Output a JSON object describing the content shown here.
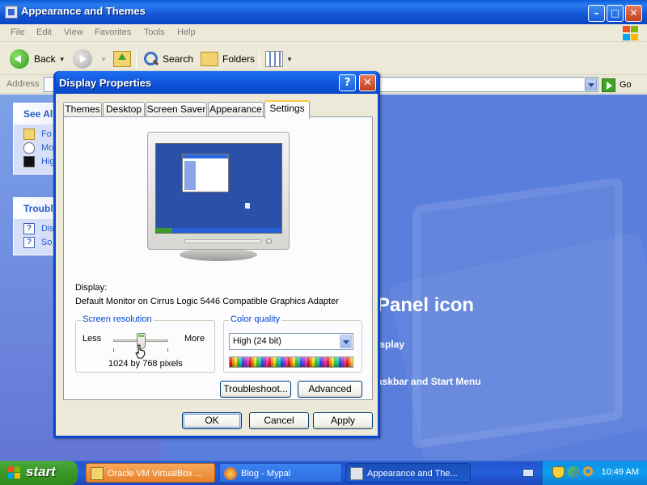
{
  "explorer": {
    "title": "Appearance and Themes",
    "menu": [
      "File",
      "Edit",
      "View",
      "Favorites",
      "Tools",
      "Help"
    ],
    "toolbar": {
      "back": "Back",
      "search": "Search",
      "folders": "Folders"
    },
    "address_label": "Address",
    "go": "Go"
  },
  "left_panes": {
    "see_also": {
      "title": "See Als",
      "items": [
        "Fo",
        "Mo",
        "Hig"
      ]
    },
    "troubleshooters": {
      "title": "Troubl",
      "items": [
        "Dis",
        "So"
      ]
    }
  },
  "main": {
    "heading": "Panel icon",
    "links": [
      "isplay",
      "askbar and Start Menu"
    ]
  },
  "dialog": {
    "title": "Display Properties",
    "help": "?",
    "tabs": [
      "Themes",
      "Desktop",
      "Screen Saver",
      "Appearance",
      "Settings"
    ],
    "active_tab": "Settings",
    "display_label": "Display:",
    "display_value": "Default Monitor on Cirrus Logic 5446 Compatible Graphics Adapter",
    "screen_resolution": {
      "title": "Screen resolution",
      "less": "Less",
      "more": "More",
      "value": "1024 by 768 pixels"
    },
    "color_quality": {
      "title": "Color quality",
      "selected": "High (24 bit)"
    },
    "troubleshoot_button": "Troubleshoot...",
    "advanced_button": "Advanced",
    "ok_button": "OK",
    "cancel_button": "Cancel",
    "apply_button": "Apply"
  },
  "taskbar": {
    "start": "start",
    "tasks": [
      "Oracle VM VirtualBox ...",
      "Blog - Mypal",
      "Appearance and The..."
    ],
    "clock": "10:49 AM"
  },
  "colors": {
    "titlebar": "#0a5cd8",
    "dialog_frame": "#0a4ad0",
    "face": "#ece9d8",
    "desktop_blue": "#5a7edc",
    "start_green": "#3c9a2a",
    "tray_blue": "#109ef0",
    "group_title": "#0046d5"
  }
}
